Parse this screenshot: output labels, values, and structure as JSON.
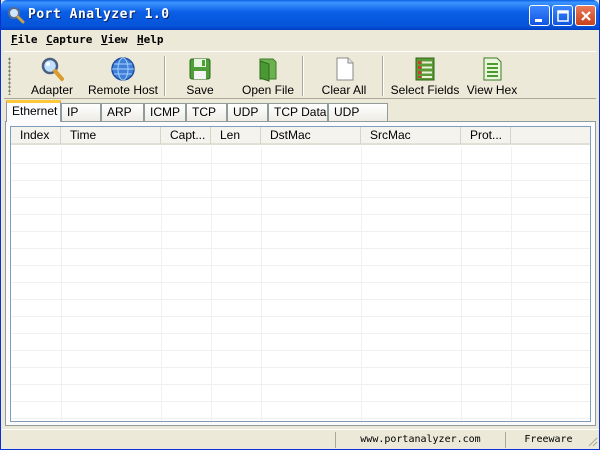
{
  "window": {
    "title": "Port Analyzer 1.0"
  },
  "menu": [
    {
      "accel": "F",
      "rest": "ile"
    },
    {
      "accel": "C",
      "rest": "apture"
    },
    {
      "accel": "V",
      "rest": "iew"
    },
    {
      "accel": "H",
      "rest": "elp"
    }
  ],
  "toolbar": {
    "adapter": "Adapter",
    "remote_host": "Remote Host",
    "save": "Save",
    "open_file": "Open File",
    "clear_all": "Clear All",
    "select_fields": "Select Fields",
    "view_hex": "View Hex"
  },
  "tabs": [
    "Ethernet",
    "IP",
    "ARP",
    "ICMP",
    "TCP",
    "UDP",
    "TCP Data",
    "UDP Data"
  ],
  "active_tab": "Ethernet",
  "columns": [
    "Index",
    "Time",
    "Capt...",
    "Len",
    "DstMac",
    "SrcMac",
    "Prot..."
  ],
  "rows": [],
  "status": {
    "url": "www.portanalyzer.com",
    "license": "Freeware"
  },
  "colors": {
    "title_bar": "#0a5fe6",
    "active_tab_highlight": "#ffc83c",
    "face": "#ece9d8"
  }
}
